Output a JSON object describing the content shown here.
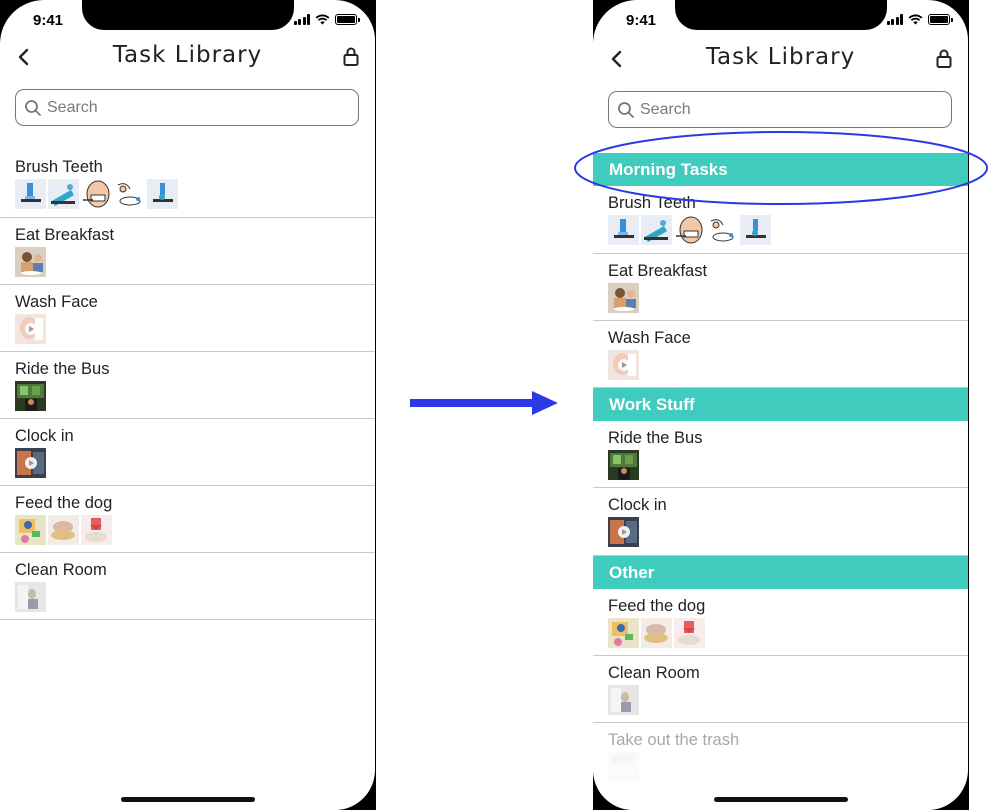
{
  "colors": {
    "section_header": "#3fcbbd",
    "annotation_blue": "#2b39e6",
    "divider": "#c8c8c8"
  },
  "left_phone": {
    "status": {
      "time": "9:41"
    },
    "nav": {
      "title": "Task Library",
      "back_icon": "chevron-left",
      "lock_icon": "lock"
    },
    "search": {
      "placeholder": "Search"
    },
    "tasks": [
      {
        "name": "Brush Teeth",
        "thumbs": [
          "toothbrush",
          "toothpaste",
          "mouth",
          "rinse",
          "brush-sink"
        ]
      },
      {
        "name": "Eat Breakfast",
        "thumbs": [
          "breakfast-photo"
        ]
      },
      {
        "name": "Wash Face",
        "thumbs": [
          "face-video"
        ]
      },
      {
        "name": "Ride the Bus",
        "thumbs": [
          "bus-photo"
        ]
      },
      {
        "name": "Clock in",
        "thumbs": [
          "clock-video"
        ]
      },
      {
        "name": "Feed the dog",
        "thumbs": [
          "dog-food",
          "bowl",
          "dog-treat"
        ]
      },
      {
        "name": "Clean Room",
        "thumbs": [
          "room-photo"
        ]
      }
    ]
  },
  "right_phone": {
    "status": {
      "time": "9:41"
    },
    "nav": {
      "title": "Task Library",
      "back_icon": "chevron-left",
      "lock_icon": "lock"
    },
    "search": {
      "placeholder": "Search"
    },
    "sections": [
      {
        "title": "Morning Tasks",
        "tasks": [
          {
            "name": "Brush Teeth",
            "thumbs": [
              "toothbrush",
              "toothpaste",
              "mouth",
              "rinse",
              "brush-sink"
            ]
          },
          {
            "name": "Eat Breakfast",
            "thumbs": [
              "breakfast-photo"
            ]
          },
          {
            "name": "Wash Face",
            "thumbs": [
              "face-video"
            ]
          }
        ]
      },
      {
        "title": "Work Stuff",
        "tasks": [
          {
            "name": "Ride the Bus",
            "thumbs": [
              "bus-photo"
            ]
          },
          {
            "name": "Clock in",
            "thumbs": [
              "clock-video"
            ]
          }
        ]
      },
      {
        "title": "Other",
        "tasks": [
          {
            "name": "Feed the dog",
            "thumbs": [
              "dog-food",
              "bowl",
              "dog-treat"
            ]
          },
          {
            "name": "Clean Room",
            "thumbs": [
              "room-photo"
            ]
          },
          {
            "name": "Take out the trash",
            "thumbs": [
              "trash-photo"
            ]
          }
        ]
      }
    ]
  }
}
